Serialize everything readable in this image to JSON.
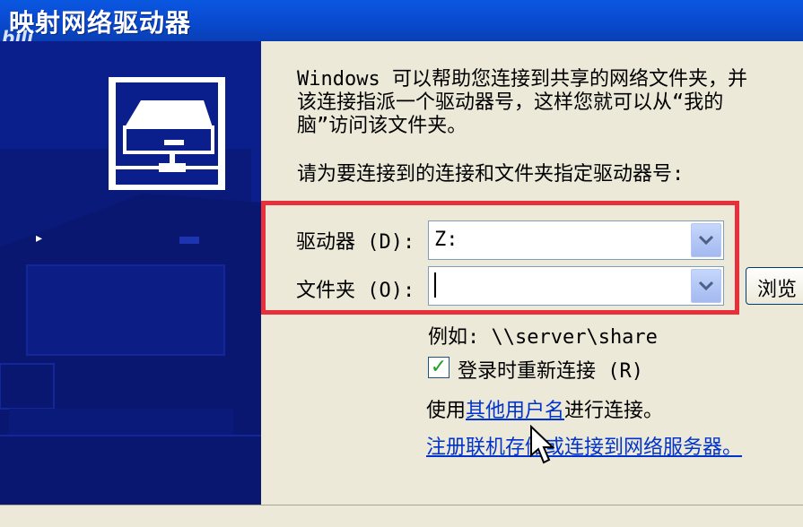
{
  "window": {
    "title": "映射网络驱动器",
    "watermark": "bili"
  },
  "description": "Windows 可以帮助您连接到共享的网络文件夹，并\n该连接指派一个驱动器号，这样您就可以从“我的\n脑”访问该文件夹。",
  "prompt": "请为要连接到的连接和文件夹指定驱动器号:",
  "drive": {
    "label": "驱动器 (D):",
    "value": "Z:"
  },
  "folder": {
    "label": "文件夹 (O):",
    "value": ""
  },
  "browse_label": "浏览",
  "example": "例如: \\\\server\\share",
  "reconnect": {
    "label": "登录时重新连接 (R)",
    "checked": true
  },
  "other_user": {
    "prefix": "使用",
    "link": "其他用户名",
    "suffix": "进行连接。"
  },
  "signup_link": "注册联机存储或连接到网络服务器。",
  "colors": {
    "titlebar": "#0a4fd8",
    "left_panel": "#0b1f8c",
    "highlight": "#e8303a",
    "link": "#0033cc"
  },
  "icons": {
    "dropdown": "chevron-down-icon",
    "check": "checkmark-icon",
    "wizard": "network-drive-icon"
  }
}
